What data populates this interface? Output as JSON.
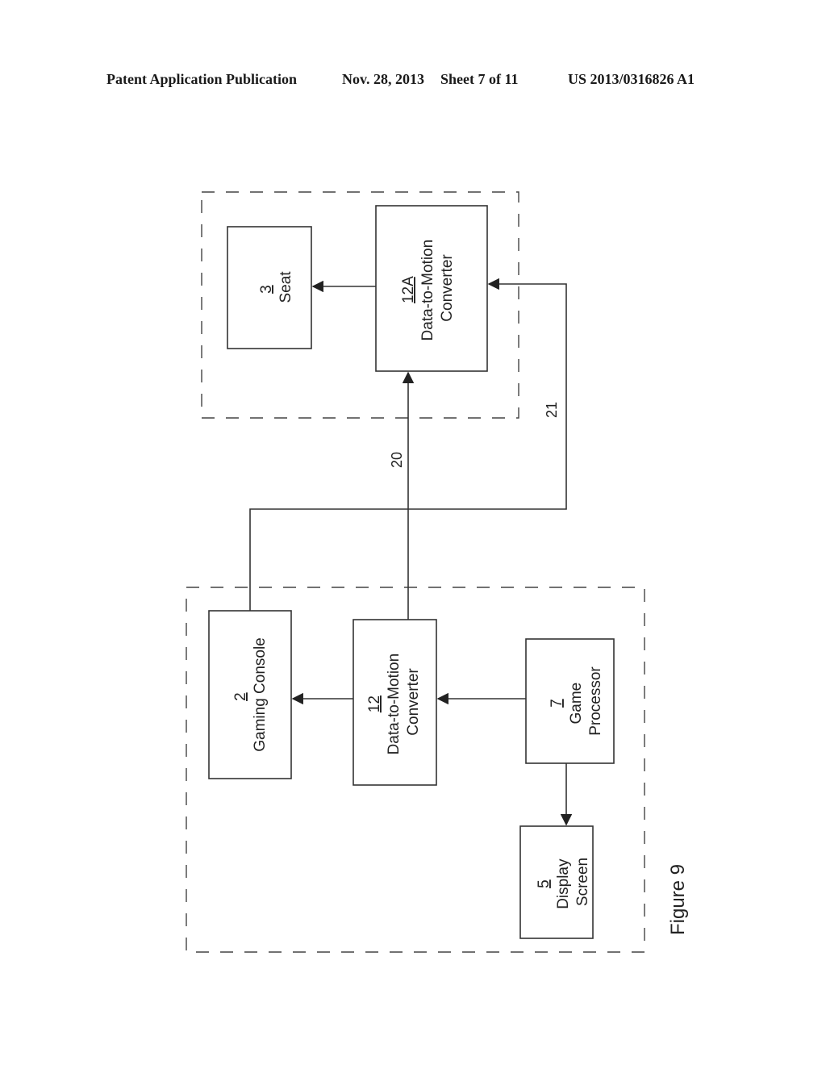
{
  "header": {
    "publication_type": "Patent Application Publication",
    "date": "Nov. 28, 2013",
    "sheet": "Sheet 7 of 11",
    "publication_number": "US 2013/0316826 A1"
  },
  "figure": {
    "caption": "Figure 9",
    "groups": [
      {
        "id": "remote-group",
        "description": "dashed enclosure containing seat and data-to-motion converter 12A"
      },
      {
        "id": "local-group",
        "description": "dashed enclosure containing gaming console, converter 12, game processor, display screen"
      }
    ],
    "blocks": {
      "seat": {
        "ref": "3",
        "label_lines": [
          "Seat"
        ]
      },
      "converter_12a": {
        "ref": "12A",
        "label_lines": [
          "Data-to-Motion",
          "Converter"
        ]
      },
      "gaming_console": {
        "ref": "2",
        "label_lines": [
          "Gaming Console"
        ]
      },
      "converter_12": {
        "ref": "12",
        "label_lines": [
          "Data-to-Motion",
          "Converter"
        ]
      },
      "game_processor": {
        "ref": "7",
        "label_lines": [
          "Game",
          "Processor"
        ]
      },
      "display_screen": {
        "ref": "5",
        "label_lines": [
          "Display",
          "Screen"
        ]
      }
    },
    "connections": [
      {
        "from": "converter_12a",
        "to": "seat",
        "label": ""
      },
      {
        "from": "converter_12",
        "to": "converter_12a",
        "label": "20"
      },
      {
        "from": "gaming_console",
        "to": "converter_12a",
        "label": "21"
      },
      {
        "from": "converter_12",
        "to": "gaming_console",
        "label": ""
      },
      {
        "from": "game_processor",
        "to": "converter_12",
        "label": ""
      },
      {
        "from": "game_processor",
        "to": "display_screen",
        "label": ""
      }
    ]
  }
}
